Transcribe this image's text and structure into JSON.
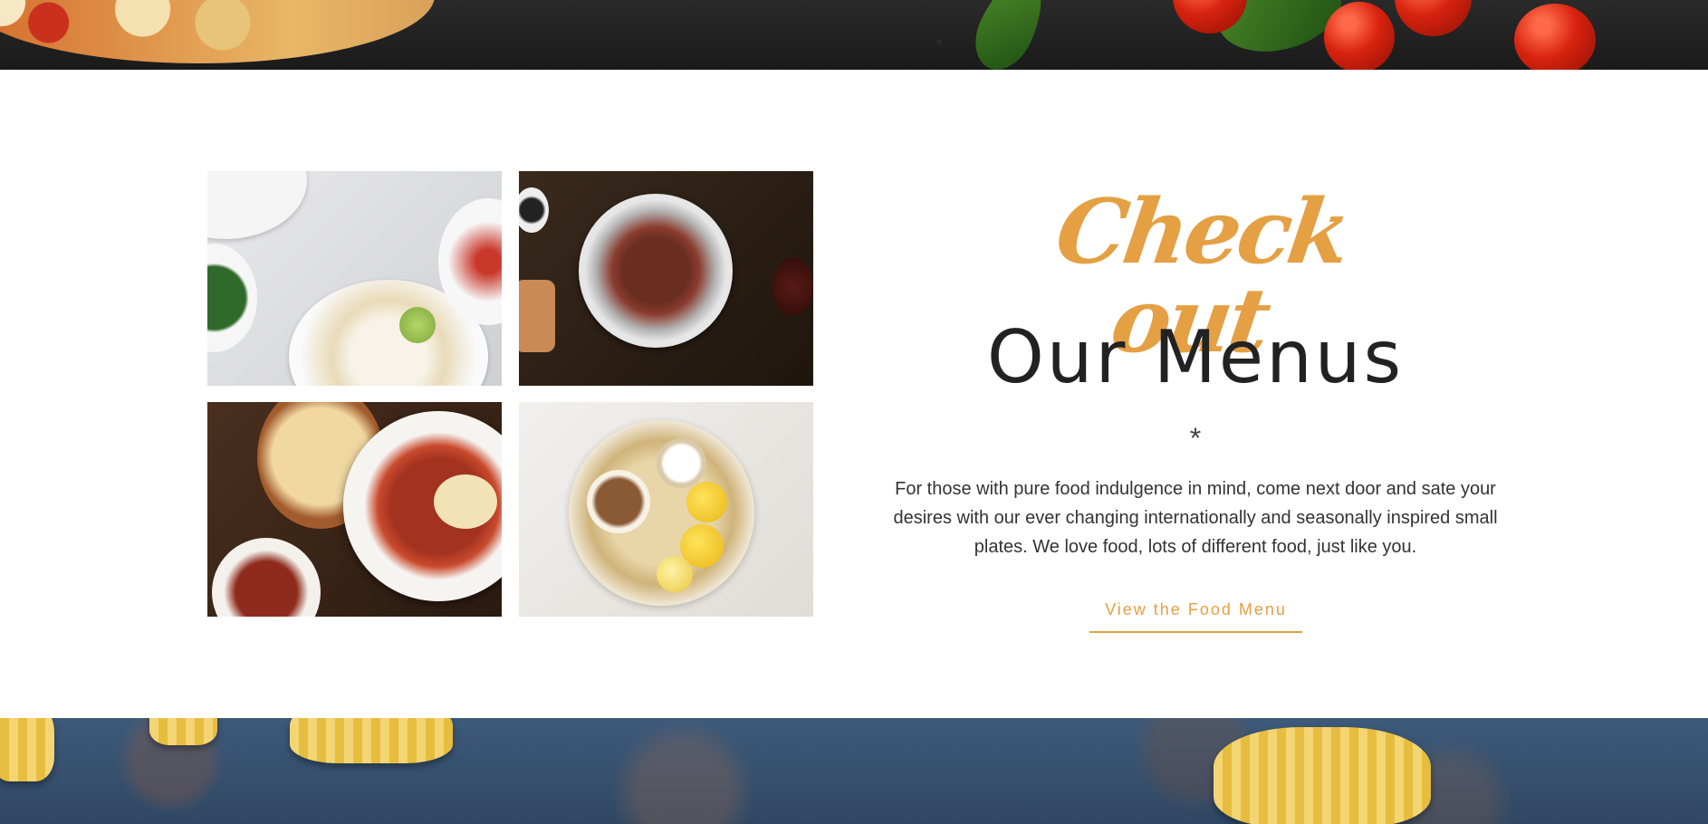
{
  "section": {
    "heading_script": "Check out",
    "heading_main": "Our Menus",
    "divider": "*",
    "description": "For those with pure food indulgence in mind, come next door and sate your desires with our ever changing internationally and seasonally inspired small plates. We love food, lots of different food, just like you.",
    "cta_label": "View the Food Menu"
  },
  "colors": {
    "accent": "#e4a043",
    "heading": "#222222",
    "body_text": "#333333"
  }
}
